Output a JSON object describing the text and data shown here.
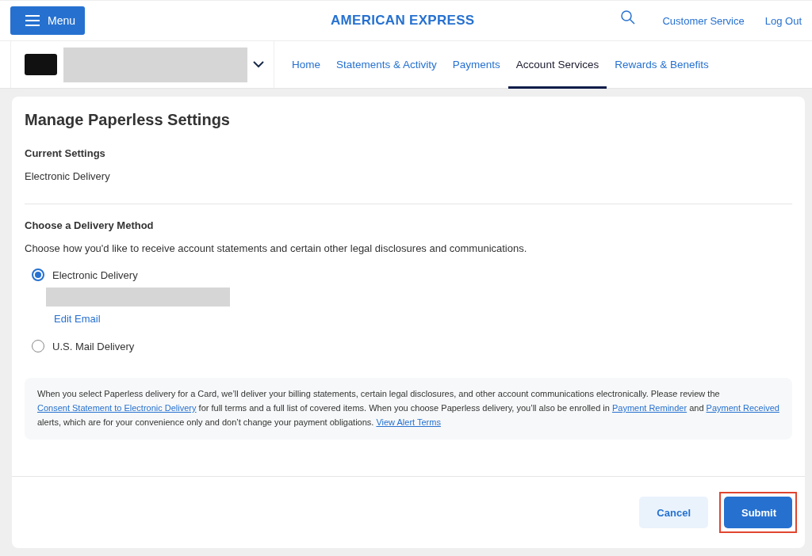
{
  "header": {
    "menu_button": "Menu",
    "logo": "AMERICAN EXPRESS",
    "links": [
      "Customer Service",
      "Log Out"
    ]
  },
  "account_selector": {
    "expanded": false
  },
  "nav": [
    {
      "label": "Home",
      "selected": false
    },
    {
      "label": "Statements & Activity",
      "selected": false
    },
    {
      "label": "Payments",
      "selected": false
    },
    {
      "label": "Account Services",
      "selected": true
    },
    {
      "label": "Rewards & Benefits",
      "selected": false
    }
  ],
  "page": {
    "title": "Manage Paperless Settings",
    "current": {
      "heading": "Current Settings",
      "value": "Electronic Delivery"
    },
    "choose": {
      "heading": "Choose a Delivery Method",
      "description": "Choose how you'd like to receive account statements and certain other legal disclosures and communications.",
      "options": [
        {
          "label": "Electronic Delivery",
          "selected": true,
          "link": "Edit Email"
        },
        {
          "label": "U.S. Mail Delivery",
          "selected": false
        }
      ]
    },
    "disclosure": [
      {
        "text": "When you select Paperless delivery for a Card, we’ll deliver your billing statements, certain legal disclosures, and other account communications electronically. Please review the ",
        "kind": "text"
      },
      {
        "text": "Consent Statement to Electronic Delivery",
        "kind": "link"
      },
      {
        "text": " for full terms and a full list of covered items. When you choose Paperless delivery, you’ll also be enrolled in ",
        "kind": "text"
      },
      {
        "text": "Payment Reminder",
        "kind": "link"
      },
      {
        "text": " and ",
        "kind": "text"
      },
      {
        "text": "Payment Received",
        "kind": "link"
      },
      {
        "text": " alerts, which are for your convenience only and don’t change your payment obligations. ",
        "kind": "text"
      },
      {
        "text": "View Alert Terms",
        "kind": "link"
      }
    ],
    "buttons": [
      {
        "label": "Cancel",
        "kind": "secondary",
        "highlighted": false
      },
      {
        "label": "Submit",
        "kind": "primary",
        "highlighted": true
      }
    ]
  }
}
